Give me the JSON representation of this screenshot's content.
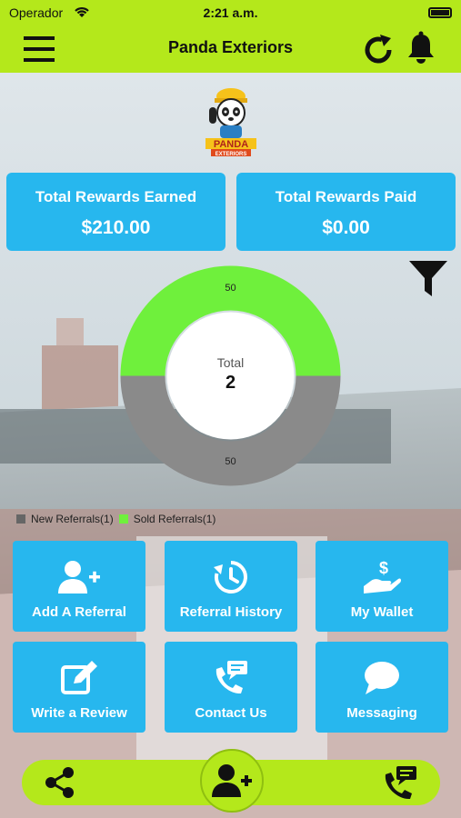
{
  "status_bar": {
    "carrier": "Operador",
    "time": "2:21 a.m."
  },
  "nav": {
    "title": "Panda Exteriors"
  },
  "logo": {
    "text": "PANDA EXTERIORS"
  },
  "rewards": {
    "earned_label": "Total Rewards Earned",
    "earned_value": "$210.00",
    "paid_label": "Total Rewards Paid",
    "paid_value": "$0.00"
  },
  "chart_data": {
    "type": "pie",
    "categories": [
      "New Referrals",
      "Sold Referrals"
    ],
    "values": [
      1,
      1
    ],
    "slice_labels": [
      "50",
      "50"
    ],
    "center_label": "Total",
    "center_value": "2",
    "colors": [
      "#8a8a8a",
      "#6ff03c"
    ]
  },
  "legend": {
    "new": "New Referrals(1)",
    "sold": "Sold Referrals(1)"
  },
  "actions": {
    "add_referral": "Add A Referral",
    "referral_history": "Referral History",
    "my_wallet": "My Wallet",
    "write_review": "Write a Review",
    "contact_us": "Contact Us",
    "messaging": "Messaging"
  },
  "colors": {
    "brand_green": "#b4e81b",
    "tile_blue": "#27b7ee"
  }
}
